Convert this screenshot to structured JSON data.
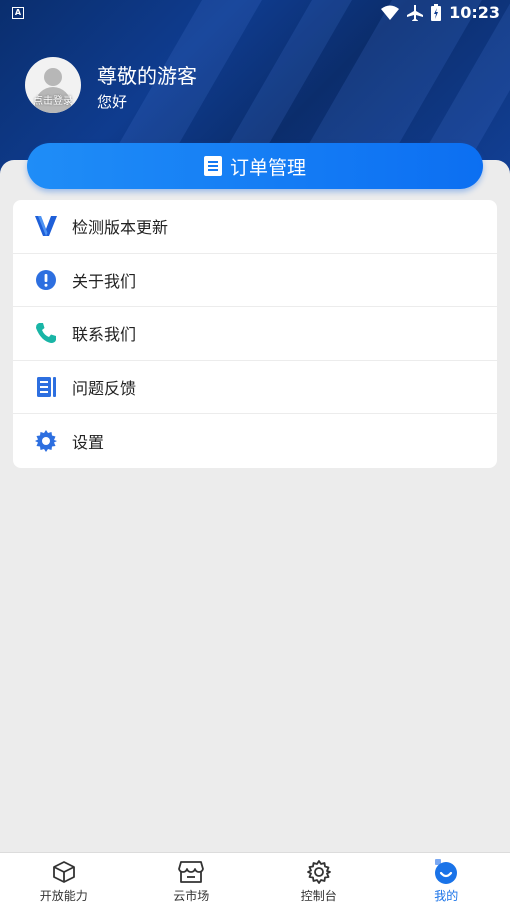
{
  "status": {
    "indicator": "A",
    "time": "10:23",
    "icons": [
      "wifi-icon",
      "airplane-icon",
      "battery-icon"
    ]
  },
  "user": {
    "name": "尊敬的游客",
    "greeting": "您好",
    "login_label": "点击登录"
  },
  "order": {
    "label": "订单管理",
    "icon": "document-icon"
  },
  "menu": {
    "items": [
      {
        "label": "检测版本更新",
        "icon": "version-v-icon"
      },
      {
        "label": "关于我们",
        "icon": "info-icon"
      },
      {
        "label": "联系我们",
        "icon": "phone-icon"
      },
      {
        "label": "问题反馈",
        "icon": "feedback-icon"
      },
      {
        "label": "设置",
        "icon": "gear-icon"
      }
    ]
  },
  "tabs": [
    {
      "label": "开放能力",
      "icon": "box-icon"
    },
    {
      "label": "云市场",
      "icon": "store-icon"
    },
    {
      "label": "控制台",
      "icon": "gear-icon"
    },
    {
      "label": "我的",
      "icon": "profile-icon",
      "active": true
    }
  ],
  "colors": {
    "header": "#0f3c8f",
    "accent": "#1479f3",
    "active_tab": "#1a73e8"
  }
}
